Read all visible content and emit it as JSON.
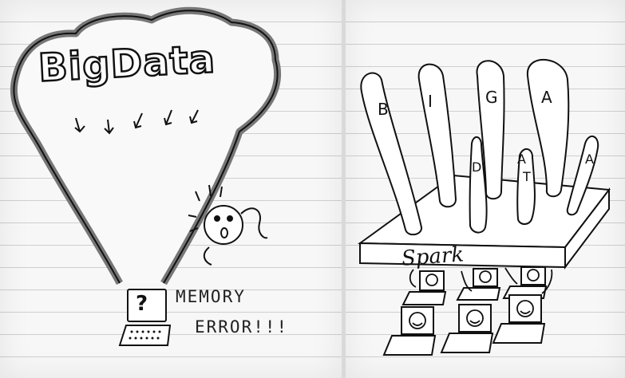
{
  "left_panel": {
    "cloud_text": "BigData",
    "error_line1": "MEMORY",
    "error_line2": "ERROR!!!",
    "laptop_symbol": "?"
  },
  "right_panel": {
    "balloon_letters": [
      "B",
      "I",
      "G",
      "A",
      "D",
      "A",
      "T",
      "A"
    ],
    "platform_label": "Spark"
  },
  "colors": {
    "paper": "#f6f6f6",
    "ink": "#111111",
    "cloud_outline": "#7a7a7a"
  }
}
